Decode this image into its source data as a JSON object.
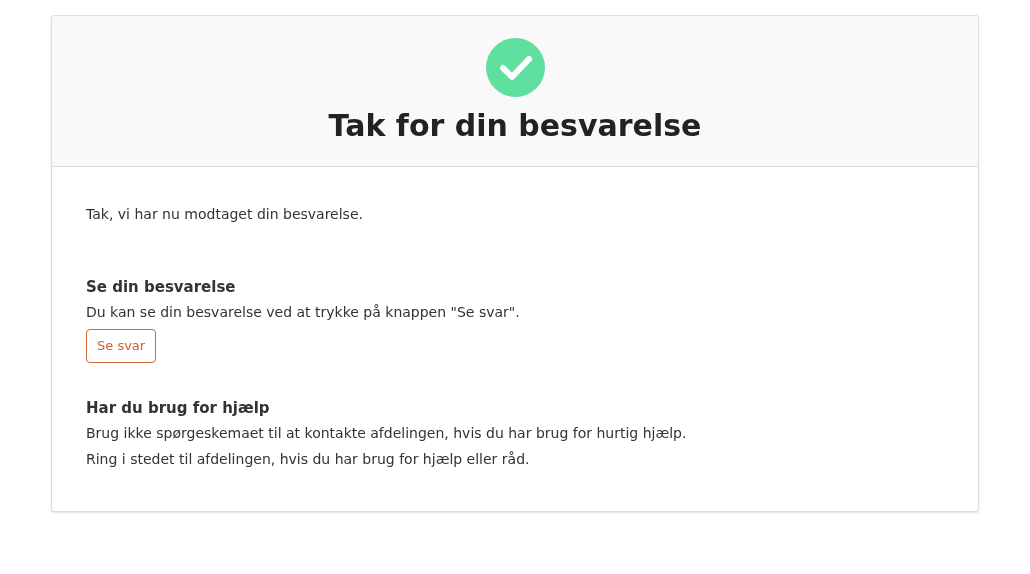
{
  "header": {
    "title": "Tak for din besvarelse"
  },
  "intro": "Tak, vi har nu modtaget din besvarelse.",
  "sections": [
    {
      "heading": "Se din besvarelse",
      "lines": [
        "Du kan se din besvarelse ved at trykke på knappen \"Se svar\"."
      ],
      "button": "Se svar"
    },
    {
      "heading": "Har du brug for hjælp",
      "lines": [
        "Brug ikke spørgeskemaet til at kontakte afdelingen, hvis du har brug for hurtig hjælp.",
        "Ring i stedet til afdelingen, hvis du har brug for hjælp eller råd."
      ]
    }
  ]
}
